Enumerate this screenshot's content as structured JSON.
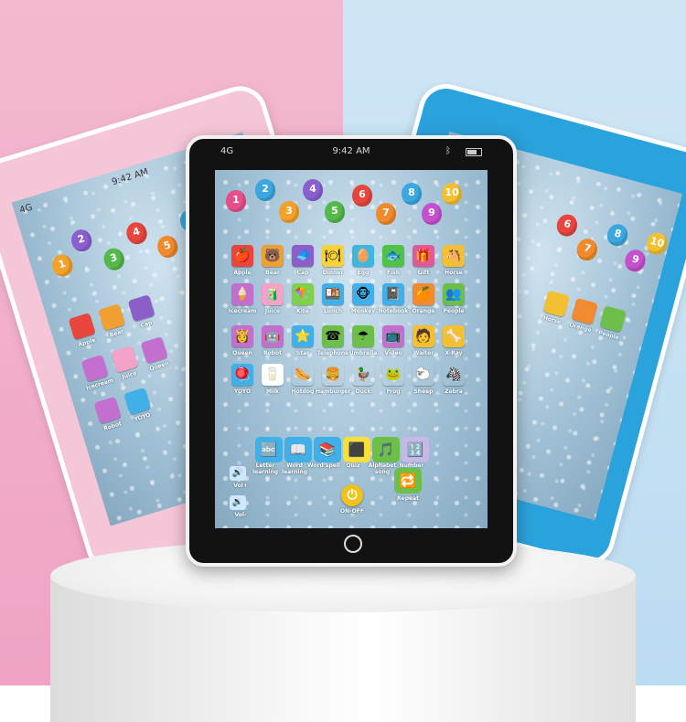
{
  "pink_tablet": {
    "status": {
      "signal": "4G",
      "time": "9:42 AM"
    },
    "numbers": [
      "1",
      "2",
      "3",
      "4",
      "5",
      "6"
    ],
    "labels": [
      "Apple",
      "Bear",
      "Cap",
      "Icecream",
      "Juice",
      "Queen",
      "Robot",
      "YOYO"
    ]
  },
  "blue_tablet": {
    "numbers": [
      "6",
      "7",
      "8",
      "9",
      "10"
    ],
    "labels": [
      "Horse",
      "Orange",
      "People"
    ]
  },
  "main_tablet": {
    "status": {
      "signal": "4G",
      "time": "9:42 AM"
    },
    "numbers": [
      "1",
      "2",
      "3",
      "4",
      "5",
      "6",
      "7",
      "8",
      "9",
      "10"
    ],
    "row1": [
      {
        "label": "Apple",
        "icon": "apple-icon",
        "glyph": "🍎",
        "color": "#e8463c"
      },
      {
        "label": "Bear",
        "icon": "bear-icon",
        "glyph": "🐻",
        "color": "#f0a030"
      },
      {
        "label": "Cap",
        "icon": "cap-icon",
        "glyph": "🧢",
        "color": "#8b5fc7"
      },
      {
        "label": "Dinner",
        "icon": "dinner-icon",
        "glyph": "🍽",
        "color": "#f7d23a"
      },
      {
        "label": "Egg",
        "icon": "egg-icon",
        "glyph": "🥚",
        "color": "#3cb8e0"
      },
      {
        "label": "Fish",
        "icon": "fish-icon",
        "glyph": "🐟",
        "color": "#4fc24a"
      },
      {
        "label": "Gift",
        "icon": "gift-icon",
        "glyph": "🎁",
        "color": "#e05a9a"
      },
      {
        "label": "Horse",
        "icon": "horse-icon",
        "glyph": "🐴",
        "color": "#f2c030"
      }
    ],
    "row2": [
      {
        "label": "Icecream",
        "icon": "icecream-icon",
        "glyph": "🍦",
        "color": "#c46fd0"
      },
      {
        "label": "Juice",
        "icon": "juice-icon",
        "glyph": "🧃",
        "color": "#f3a2c8"
      },
      {
        "label": "Kite",
        "icon": "kite-icon",
        "glyph": "🪁",
        "color": "#7fd04a"
      },
      {
        "label": "Lunch",
        "icon": "lunch-icon",
        "glyph": "🍱",
        "color": "#3fb0e8"
      },
      {
        "label": "Monkey",
        "icon": "monkey-icon",
        "glyph": "🐵",
        "color": "#3fb0e8"
      },
      {
        "label": "Notebook",
        "icon": "notebook-icon",
        "glyph": "📓",
        "color": "#3fb0e8"
      },
      {
        "label": "Orange",
        "icon": "orange-icon",
        "glyph": "🍊",
        "color": "#f28a30"
      },
      {
        "label": "People",
        "icon": "people-icon",
        "glyph": "👥",
        "color": "#6cc04a"
      }
    ],
    "row3": [
      {
        "label": "Queen",
        "icon": "queen-icon",
        "glyph": "👸",
        "color": "#c46fd0"
      },
      {
        "label": "Robot",
        "icon": "robot-icon",
        "glyph": "🤖",
        "color": "#c46fd0"
      },
      {
        "label": "Star",
        "icon": "star-icon",
        "glyph": "⭐",
        "color": "#3fb0e8"
      },
      {
        "label": "Telephone",
        "icon": "telephone-icon",
        "glyph": "☎",
        "color": "#6cc04a"
      },
      {
        "label": "Umbrella",
        "icon": "umbrella-icon",
        "glyph": "☂",
        "color": "#6cc04a"
      },
      {
        "label": "Video",
        "icon": "video-icon",
        "glyph": "📺",
        "color": "#c46fd0"
      },
      {
        "label": "Waiter",
        "icon": "waiter-icon",
        "glyph": "🧑",
        "color": "#f2c030"
      },
      {
        "label": "X-Ray",
        "icon": "xray-icon",
        "glyph": "🦴",
        "color": "#f2c030"
      }
    ],
    "row4": [
      {
        "label": "YOYO",
        "icon": "yoyo-icon",
        "glyph": "🪀",
        "color": "#3fb0e8"
      },
      {
        "label": "Milk",
        "icon": "milk-icon",
        "glyph": "🥛",
        "color": "#ffffff"
      },
      {
        "label": "Hotdog",
        "icon": "hotdog-icon",
        "glyph": "🌭",
        "color": "transparent"
      },
      {
        "label": "Hamburger",
        "icon": "hamburger-icon",
        "glyph": "🍔",
        "color": "transparent"
      },
      {
        "label": "Duck",
        "icon": "duck-icon",
        "glyph": "🦆",
        "color": "transparent"
      },
      {
        "label": "Frog",
        "icon": "frog-icon",
        "glyph": "🐸",
        "color": "transparent"
      },
      {
        "label": "Sheep",
        "icon": "sheep-icon",
        "glyph": "🐑",
        "color": "transparent"
      },
      {
        "label": "Zebra",
        "icon": "zebra-icon",
        "glyph": "🦓",
        "color": "transparent"
      }
    ],
    "functions": [
      {
        "label": "Letter learning",
        "icon": "letter-learning-icon",
        "glyph": "🔤",
        "color": "#3fb0e8"
      },
      {
        "label": "Word learning",
        "icon": "word-learning-icon",
        "glyph": "📖",
        "color": "#3fb0e8"
      },
      {
        "label": "Word spell",
        "icon": "word-spell-icon",
        "glyph": "📚",
        "color": "#3fb0e8"
      },
      {
        "label": "Quiz",
        "icon": "quiz-icon",
        "glyph": "⬛",
        "color": "#f7e03a"
      },
      {
        "label": "Alphabet song",
        "icon": "alphabet-song-icon",
        "glyph": "🎵",
        "color": "#6cc04a"
      },
      {
        "label": "Number song",
        "icon": "number-song-icon",
        "glyph": "🔢",
        "color": "#c8b7e8"
      }
    ],
    "controls": {
      "vol_up": "Vol+",
      "vol_down": "Vol-",
      "power": "ON-OFF",
      "repeat": "Repeat"
    }
  }
}
